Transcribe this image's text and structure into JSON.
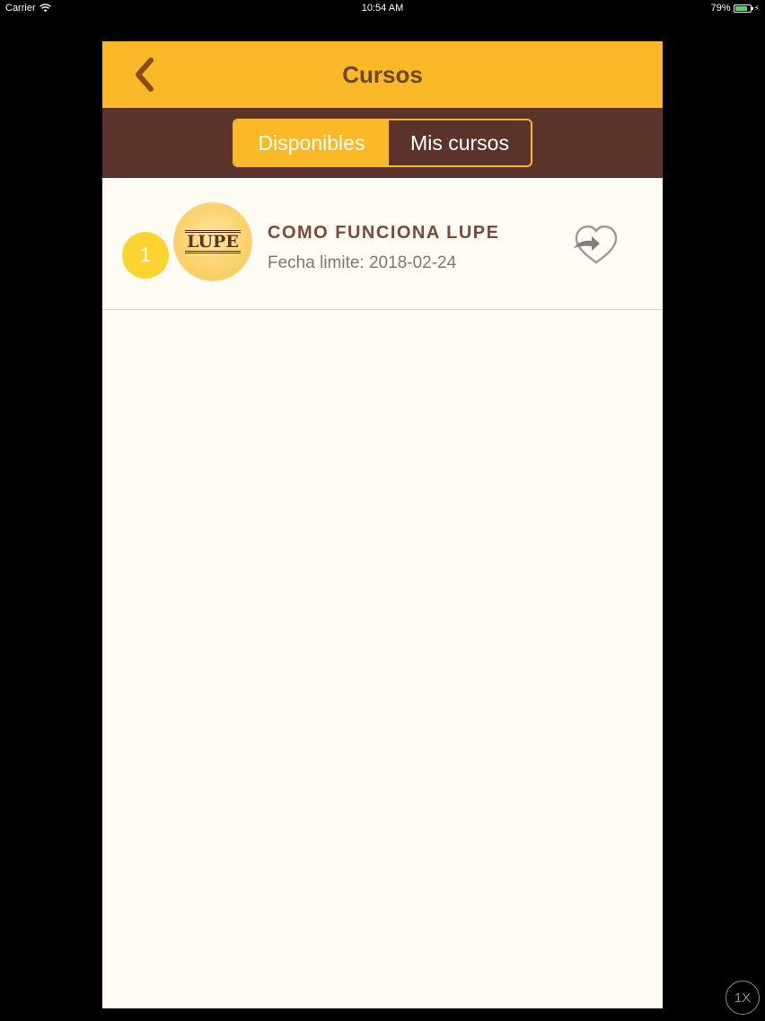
{
  "status_bar": {
    "carrier": "Carrier",
    "time": "10:54 AM",
    "battery_percent": "79%",
    "battery_level": 0.79,
    "battery_color": "#4cd964"
  },
  "nav": {
    "title": "Cursos",
    "back_icon": "chevron-left-icon",
    "color": "#fbb928"
  },
  "tabs": [
    {
      "label": "Disponibles",
      "selected": true
    },
    {
      "label": "Mis cursos",
      "selected": false
    }
  ],
  "courses": [
    {
      "rank": "1",
      "logo_text": "LUPE",
      "title": "COMO FUNCIONA LUPE",
      "deadline": "Fecha limite: 2018-02-24",
      "action_icon": "heart-share-icon"
    }
  ],
  "overlay": {
    "speed_label": "1X"
  },
  "colors": {
    "accent": "#fbb928",
    "dark_brown": "#5a342b",
    "background": "#fffcf4",
    "badge": "#fdd330"
  }
}
